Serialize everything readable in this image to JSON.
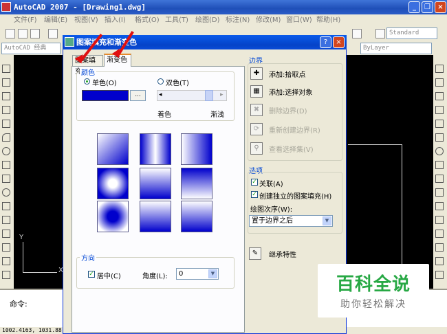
{
  "app": {
    "title": "AutoCAD 2007 - [Drawing1.dwg]",
    "minimize": "_",
    "restore": "❐",
    "close": "×"
  },
  "menu": [
    "文件(F)",
    "编辑(E)",
    "视图(V)",
    "插入(I)",
    "格式(O)",
    "工具(T)",
    "绘图(D)",
    "标注(N)",
    "修改(M)",
    "窗口(W)",
    "帮助(H)"
  ],
  "toolbars": {
    "workspace": "AutoCAD 经典",
    "text_style": "Standard",
    "layer_combo": "ByLayer"
  },
  "dialog": {
    "title": "图案填充和渐变色",
    "help": "?",
    "close": "×",
    "tabs": [
      "图案填充",
      "渐变色"
    ],
    "color_group": "颜色",
    "one_color": "单色(O)",
    "two_color": "双色(T)",
    "color_button": "...",
    "shade_label": "着色",
    "tint_label": "渐浅",
    "orientation_group": "方向",
    "centered": "居中(C)",
    "angle_label": "角度(L):",
    "angle_value": "0",
    "boundaries_title": "边界",
    "boundary_actions": [
      {
        "icon": "pick-points-icon",
        "label": "添加:拾取点",
        "enabled": true
      },
      {
        "icon": "select-objects-icon",
        "label": "添加:选择对象",
        "enabled": true
      },
      {
        "icon": "remove-boundaries-icon",
        "label": "删除边界(D)",
        "enabled": false
      },
      {
        "icon": "recreate-boundary-icon",
        "label": "重新创建边界(R)",
        "enabled": false
      },
      {
        "icon": "view-selections-icon",
        "label": "查看选择集(V)",
        "enabled": false
      }
    ],
    "options_title": "选项",
    "associative": "关联(A)",
    "create_separate": "创建独立的图案填充(H)",
    "draw_order_label": "绘图次序(W):",
    "draw_order_value": "置于边界之后",
    "inherit": "继承特性"
  },
  "command": {
    "prompt": "命令:"
  },
  "status": {
    "coords": "1002.4163, 1031.88"
  },
  "ucs": {
    "y": "Y",
    "x": "X"
  },
  "watermark": {
    "main": "百科全说",
    "sub": "助你轻松解决"
  },
  "colors": {
    "gradient_blue": "#0000cc",
    "title_blue": "#0543c8",
    "arrow_red": "#e01010",
    "watermark_green": "#27a844"
  }
}
